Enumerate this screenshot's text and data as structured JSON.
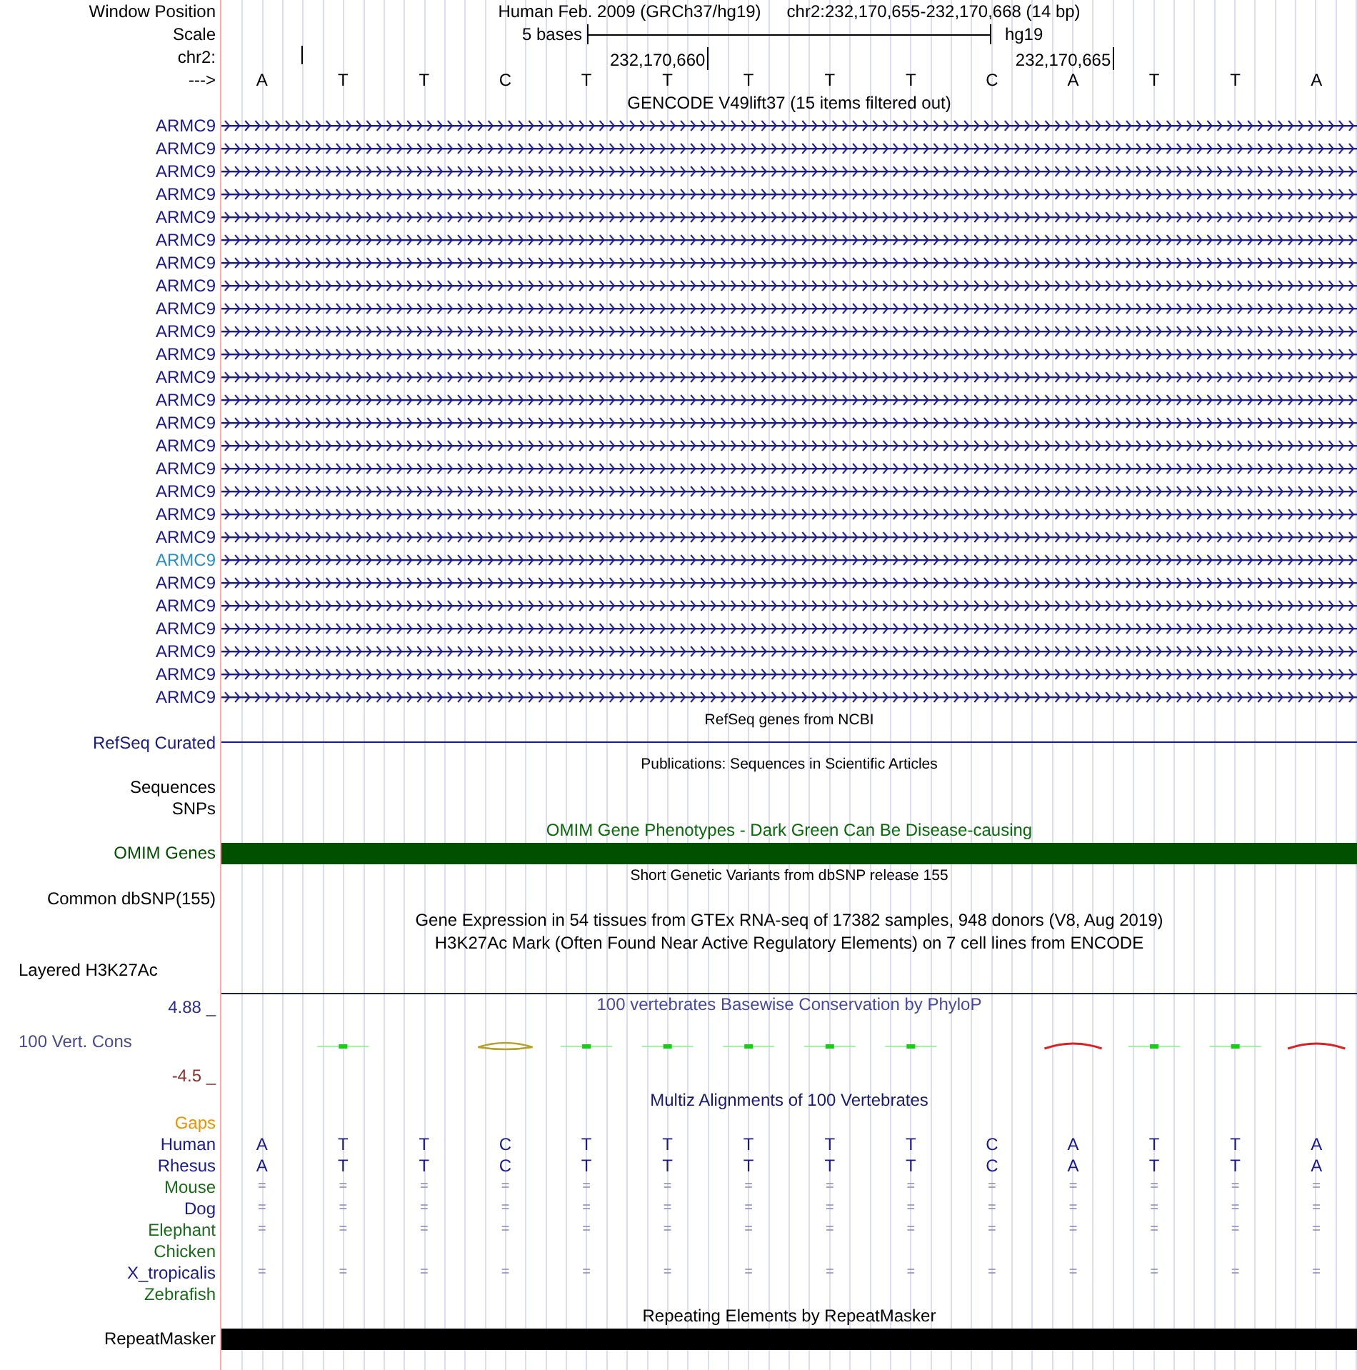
{
  "header": {
    "window_position_label": "Window Position",
    "assembly": "Human Feb. 2009 (GRCh37/hg19)",
    "position": "chr2:232,170,655-232,170,668 (14 bp)",
    "scale_label": "Scale",
    "scale_text": "5 bases",
    "scale_db": "hg19",
    "chrom_label": "chr2:",
    "ticks": [
      "232,170,660",
      "232,170,665"
    ],
    "strand_label": "--->",
    "bases": [
      "A",
      "T",
      "T",
      "C",
      "T",
      "T",
      "T",
      "T",
      "T",
      "C",
      "A",
      "T",
      "T",
      "A"
    ]
  },
  "tracks": [
    {
      "kind": "title",
      "text": "GENCODE V49lift37 (15 items filtered out)",
      "color": "#000000"
    },
    {
      "kind": "gene",
      "label": "ARMC9",
      "selected": false
    },
    {
      "kind": "gene",
      "label": "ARMC9",
      "selected": false
    },
    {
      "kind": "gene",
      "label": "ARMC9",
      "selected": false
    },
    {
      "kind": "gene",
      "label": "ARMC9",
      "selected": false
    },
    {
      "kind": "gene",
      "label": "ARMC9",
      "selected": false
    },
    {
      "kind": "gene",
      "label": "ARMC9",
      "selected": false
    },
    {
      "kind": "gene",
      "label": "ARMC9",
      "selected": false
    },
    {
      "kind": "gene",
      "label": "ARMC9",
      "selected": false
    },
    {
      "kind": "gene",
      "label": "ARMC9",
      "selected": false
    },
    {
      "kind": "gene",
      "label": "ARMC9",
      "selected": false
    },
    {
      "kind": "gene",
      "label": "ARMC9",
      "selected": false
    },
    {
      "kind": "gene",
      "label": "ARMC9",
      "selected": false
    },
    {
      "kind": "gene",
      "label": "ARMC9",
      "selected": false
    },
    {
      "kind": "gene",
      "label": "ARMC9",
      "selected": false
    },
    {
      "kind": "gene",
      "label": "ARMC9",
      "selected": false
    },
    {
      "kind": "gene",
      "label": "ARMC9",
      "selected": false
    },
    {
      "kind": "gene",
      "label": "ARMC9",
      "selected": false
    },
    {
      "kind": "gene",
      "label": "ARMC9",
      "selected": false
    },
    {
      "kind": "gene",
      "label": "ARMC9",
      "selected": false
    },
    {
      "kind": "gene",
      "label": "ARMC9",
      "selected": true
    },
    {
      "kind": "gene",
      "label": "ARMC9",
      "selected": false
    },
    {
      "kind": "gene",
      "label": "ARMC9",
      "selected": false
    },
    {
      "kind": "gene",
      "label": "ARMC9",
      "selected": false
    },
    {
      "kind": "gene",
      "label": "ARMC9",
      "selected": false
    },
    {
      "kind": "gene",
      "label": "ARMC9",
      "selected": false
    },
    {
      "kind": "gene",
      "label": "ARMC9",
      "selected": false
    },
    {
      "kind": "small_title",
      "text": "RefSeq genes from NCBI"
    },
    {
      "kind": "line",
      "label": "RefSeq Curated",
      "color": "#1a1a8c"
    },
    {
      "kind": "small_title",
      "text": "Publications: Sequences in Scientific Articles"
    },
    {
      "kind": "empty",
      "label": "Sequences"
    },
    {
      "kind": "empty",
      "label": "SNPs"
    },
    {
      "kind": "title",
      "text": "OMIM Gene Phenotypes - Dark Green Can Be Disease-causing",
      "color": "#0a6a0a"
    },
    {
      "kind": "bar",
      "label": "OMIM Genes",
      "color": "#005000"
    },
    {
      "kind": "small_title",
      "text": "Short Genetic Variants from dbSNP release 155"
    },
    {
      "kind": "empty",
      "label": "Common dbSNP(155)"
    },
    {
      "kind": "title",
      "text": "Gene Expression in 54 tissues from GTEx RNA-seq of 17382 samples, 948 donors (V8, Aug 2019)",
      "color": "#000000"
    },
    {
      "kind": "title",
      "text": "H3K27Ac Mark (Often Found Near Active Regulatory Elements) on 7 cell lines from ENCODE",
      "color": "#000000"
    },
    {
      "kind": "left_label",
      "label": "Layered H3K27Ac"
    },
    {
      "kind": "wiggle",
      "title": "100 vertebrates Basewise Conservation by PhyloP",
      "label": "100 Vert. Cons",
      "ymax": "4.88 _",
      "ymin": "-4.5 _"
    },
    {
      "kind": "title",
      "text": "Multiz Alignments of 100 Vertebrates",
      "color": "#1a1a6c"
    },
    {
      "kind": "empty",
      "label": "Gaps",
      "color": "#e69500"
    },
    {
      "kind": "align",
      "label": "Human",
      "color": "#1a1a8c",
      "bases": [
        "A",
        "T",
        "T",
        "C",
        "T",
        "T",
        "T",
        "T",
        "T",
        "C",
        "A",
        "T",
        "T",
        "A"
      ]
    },
    {
      "kind": "align",
      "label": "Rhesus",
      "color": "#1a1a8c",
      "bases": [
        "A",
        "T",
        "T",
        "C",
        "T",
        "T",
        "T",
        "T",
        "T",
        "C",
        "A",
        "T",
        "T",
        "A"
      ]
    },
    {
      "kind": "align",
      "label": "Mouse",
      "color": "#1a6b1a",
      "bases": [
        "=",
        "=",
        "=",
        "=",
        "=",
        "=",
        "=",
        "=",
        "=",
        "=",
        "=",
        "=",
        "=",
        "="
      ]
    },
    {
      "kind": "align",
      "label": "Dog",
      "color": "#1a1a8c",
      "bases": [
        "=",
        "=",
        "=",
        "=",
        "=",
        "=",
        "=",
        "=",
        "=",
        "=",
        "=",
        "=",
        "=",
        "="
      ]
    },
    {
      "kind": "align",
      "label": "Elephant",
      "color": "#1a6b1a",
      "bases": [
        "=",
        "=",
        "=",
        "=",
        "=",
        "=",
        "=",
        "=",
        "=",
        "=",
        "=",
        "=",
        "=",
        "="
      ]
    },
    {
      "kind": "align",
      "label": "Chicken",
      "color": "#1a6b1a"
    },
    {
      "kind": "align",
      "label": "X_tropicalis",
      "color": "#1a1a8c",
      "bases": [
        "=",
        "=",
        "=",
        "=",
        "=",
        "=",
        "=",
        "=",
        "=",
        "=",
        "=",
        "=",
        "=",
        "="
      ]
    },
    {
      "kind": "align",
      "label": "Zebrafish",
      "color": "#1a6b1a"
    },
    {
      "kind": "title",
      "text": "Repeating Elements by RepeatMasker",
      "color": "#000000"
    },
    {
      "kind": "bar",
      "label": "RepeatMasker",
      "color": "#000000"
    }
  ]
}
